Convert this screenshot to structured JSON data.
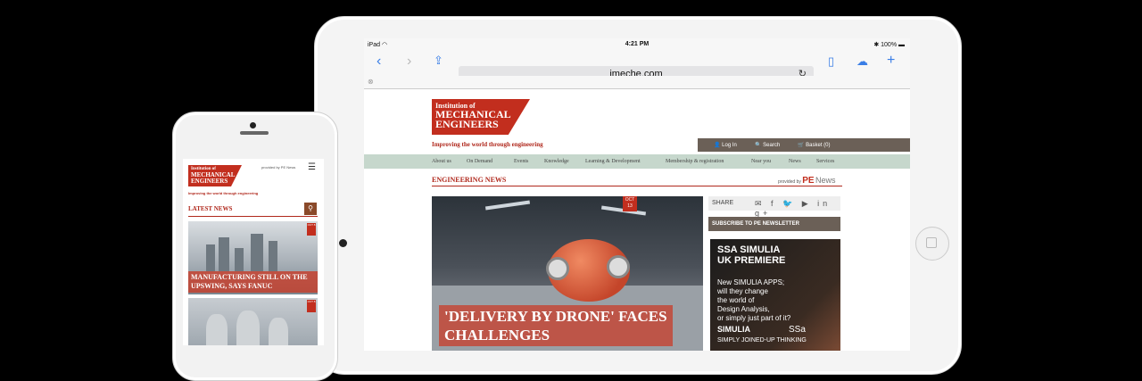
{
  "ipad": {
    "status": {
      "carrier": "iPad ◠",
      "time": "4:21 PM",
      "battery": "✱ 100% ▬"
    },
    "url": "imeche.com",
    "site": {
      "logo_line1": "Institution of",
      "logo_line2": "MECHANICAL",
      "logo_line3": "ENGINEERS",
      "tagline": "Improving the world through engineering",
      "user_links": [
        "Log In",
        "Search",
        "Basket (0)"
      ],
      "nav": [
        "About us",
        "On Demand",
        "Events",
        "Knowledge",
        "Learning & Development",
        "Membership & registration",
        "Near you",
        "News",
        "Services"
      ],
      "section_title": "ENGINEERING NEWS",
      "provided_by": "provided by",
      "pe": "PE",
      "news": "News",
      "hero_date_m": "OCT",
      "hero_date_d": "13",
      "hero_title_1": "'DELIVERY BY DRONE' FACES",
      "hero_title_2": "CHALLENGES",
      "share_label": "SHARE",
      "share_icons": "✉ f 🐦 ▶ in g+",
      "subscribe": "SUBSCRIBE TO PE NEWSLETTER",
      "ad": {
        "l1": "SSA SIMULIA",
        "l2": "UK PREMIERE",
        "l3": "New SIMULIA APPS;",
        "l4": "will they change",
        "l5": "the world of",
        "l6": "Design Analysis,",
        "l7": "or simply just part of it?",
        "brand": "SIMULIA",
        "ssa": "SSa",
        "foot": "SIMPLY JOINED-UP THINKING"
      }
    }
  },
  "iphone": {
    "logo_line1": "Institution of",
    "logo_line2": "MECHANICAL",
    "logo_line3": "ENGINEERS",
    "provided": "provided by PE News",
    "tagline": "Improving the world through engineering",
    "latest": "LATEST NEWS",
    "card1_date": "OCT 8",
    "card1_title": "MANUFACTURING STILL ON THE UPSWING, SAYS FANUC",
    "card2_date": "OCT 8"
  }
}
